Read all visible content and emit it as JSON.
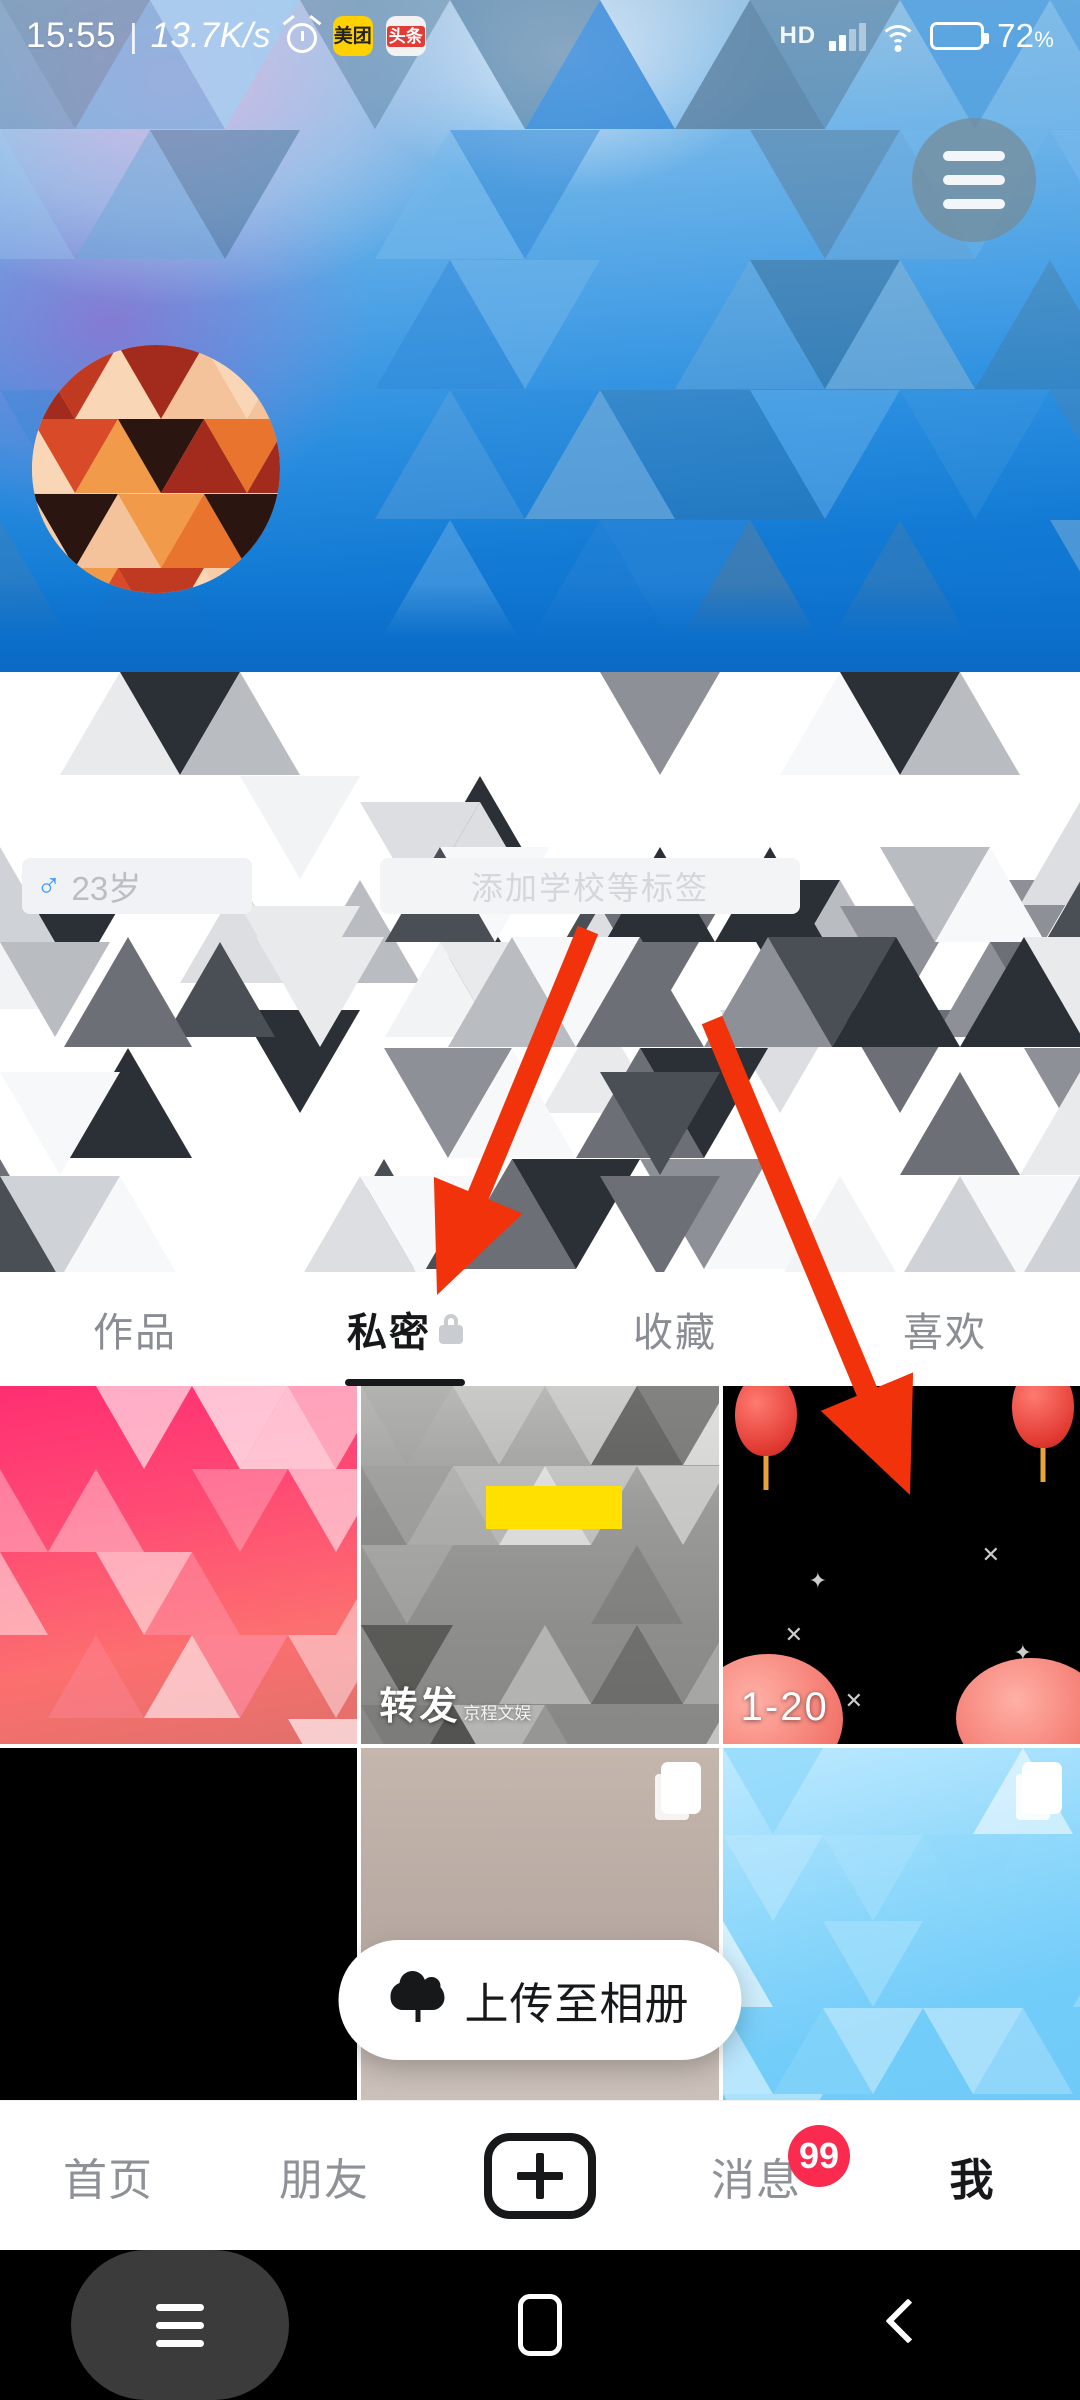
{
  "status_bar": {
    "time": "15:55",
    "separator": "|",
    "network_speed": "13.7K/s",
    "alarm_icon": "alarm-clock-icon",
    "app_icons": [
      {
        "name": "meituan-app-icon",
        "label": "美团"
      },
      {
        "name": "toutiao-app-icon",
        "label": "头条"
      }
    ],
    "hd_label": "HD",
    "signal_icon": "cellular-signal-icon",
    "wifi_icon": "wifi-icon",
    "battery_icon": "battery-icon",
    "battery_percent": "72",
    "battery_percent_symbol": "%",
    "battery_level": 72,
    "battery_color": "#f2a01e"
  },
  "header": {
    "menu_button_icon": "hamburger-menu-icon",
    "avatar_name": "profile-avatar"
  },
  "profile": {
    "gender_icon": "male-gender-icon",
    "gender_symbol": "♂",
    "age": "23岁",
    "tag_placeholder": "添加学校等标签",
    "censored": true
  },
  "tabs": [
    {
      "label": "作品",
      "active": false,
      "lock": false
    },
    {
      "label": "私密",
      "active": true,
      "lock": true
    },
    {
      "label": "收藏",
      "active": false,
      "lock": false
    },
    {
      "label": "喜欢",
      "active": false,
      "lock": false
    }
  ],
  "grid": [
    {
      "name": "grid-item-1",
      "caption": "",
      "sub": ""
    },
    {
      "name": "grid-item-2",
      "caption": "转发",
      "sub": "京程文娱"
    },
    {
      "name": "grid-item-3",
      "caption": "1-20",
      "sub": ""
    },
    {
      "name": "grid-item-4",
      "caption": "",
      "sub": ""
    },
    {
      "name": "grid-item-5",
      "caption": "",
      "sub": ""
    },
    {
      "name": "grid-item-6",
      "caption": "",
      "sub": ""
    }
  ],
  "upload_fab": {
    "label": "上传至相册",
    "icon": "cloud-upload-icon"
  },
  "bottom_nav": [
    {
      "label": "首页",
      "active": false,
      "badge": "",
      "type": "text"
    },
    {
      "label": "朋友",
      "active": false,
      "badge": "",
      "type": "text"
    },
    {
      "label": "",
      "active": false,
      "badge": "",
      "type": "plus"
    },
    {
      "label": "消息",
      "active": false,
      "badge": "99",
      "type": "text"
    },
    {
      "label": "我",
      "active": true,
      "badge": "",
      "type": "text"
    }
  ],
  "android_nav": [
    {
      "name": "recents-button",
      "icon": "recents-icon"
    },
    {
      "name": "home-button",
      "icon": "home-icon"
    },
    {
      "name": "back-button",
      "icon": "back-chevron-icon"
    }
  ],
  "annotations": {
    "arrow_color": "#f2320a",
    "arrow_1_target": "私密 tab",
    "arrow_2_target": "grid-item-3"
  }
}
